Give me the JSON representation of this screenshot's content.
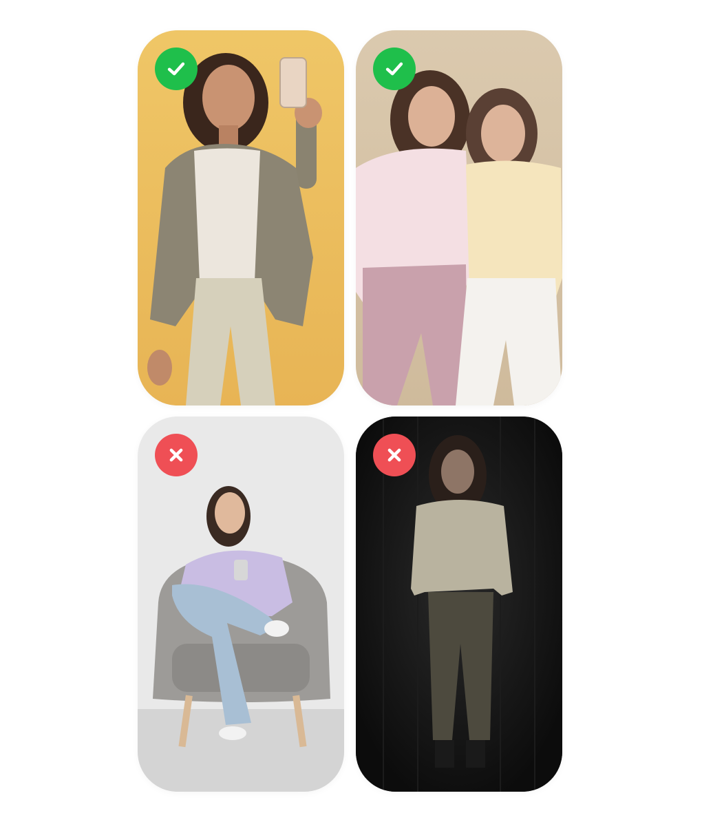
{
  "examples": [
    {
      "id": "selfie-standing",
      "verdict": "approved",
      "badge_icon": "checkmark-icon",
      "badge_color": "#1fbf4b",
      "background_color": "#eec262"
    },
    {
      "id": "two-friends",
      "verdict": "approved",
      "badge_icon": "checkmark-icon",
      "badge_color": "#1fbf4b",
      "background_color": "#d9c7ac"
    },
    {
      "id": "sitting-armchair",
      "verdict": "rejected",
      "badge_icon": "cross-icon",
      "badge_color": "#ef4f55",
      "background_color": "#e9e9e9"
    },
    {
      "id": "dark-low-light",
      "verdict": "rejected",
      "badge_icon": "cross-icon",
      "badge_color": "#ef4f55",
      "background_color": "#141414"
    }
  ]
}
